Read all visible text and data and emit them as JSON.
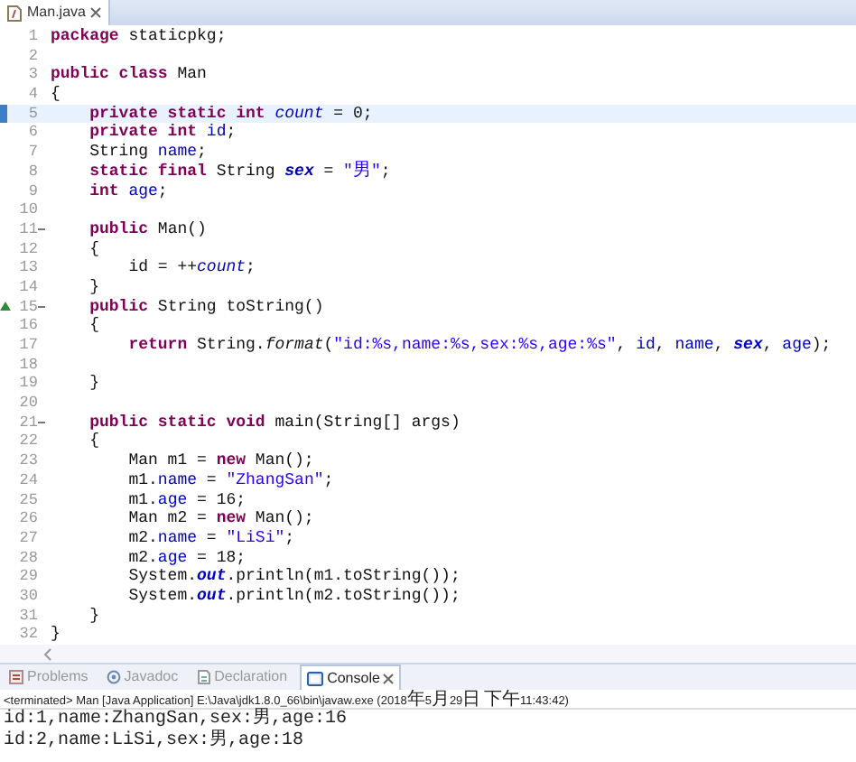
{
  "editor_tab": {
    "title": "Man.java",
    "selected": true
  },
  "lines": [
    {
      "number": "1",
      "current": false,
      "fold": false,
      "override": false,
      "tokens": [
        {
          "kind": "kw",
          "text": "package"
        },
        {
          "kind": "plain",
          "text": " staticpkg;"
        }
      ]
    },
    {
      "number": "2",
      "current": false,
      "fold": false,
      "override": false
    },
    {
      "number": "3",
      "current": false,
      "fold": false,
      "override": false,
      "tokens": [
        {
          "kind": "kw",
          "text": "public class"
        },
        {
          "kind": "plain",
          "text": " Man"
        }
      ]
    },
    {
      "number": "4",
      "current": false,
      "fold": false,
      "override": false,
      "tokens": [
        {
          "kind": "plain",
          "text": "{"
        }
      ]
    },
    {
      "number": "5",
      "current": true,
      "fold": false,
      "override": false,
      "tokens": [
        {
          "kind": "kw",
          "text": "    private static int "
        },
        {
          "kind": "sfield",
          "text": "count"
        },
        {
          "kind": "plain",
          "text": " = 0;"
        }
      ]
    },
    {
      "number": "6",
      "current": false,
      "fold": false,
      "override": false,
      "tokens": [
        {
          "kind": "kw",
          "text": "    private int "
        },
        {
          "kind": "field",
          "text": "id"
        },
        {
          "kind": "plain",
          "text": ";"
        }
      ]
    },
    {
      "number": "7",
      "current": false,
      "fold": false,
      "override": false,
      "tokens": [
        {
          "kind": "plain",
          "text": "    String "
        },
        {
          "kind": "field",
          "text": "name"
        },
        {
          "kind": "plain",
          "text": ";"
        }
      ]
    },
    {
      "number": "8",
      "current": false,
      "fold": false,
      "override": false,
      "tokens": [
        {
          "kind": "kw",
          "text": "    static final"
        },
        {
          "kind": "plain",
          "text": " String "
        },
        {
          "kind": "sfinal",
          "text": "sex"
        },
        {
          "kind": "plain",
          "text": " = "
        },
        {
          "kind": "str",
          "text": "\"男\""
        },
        {
          "kind": "plain",
          "text": ";"
        }
      ]
    },
    {
      "number": "9",
      "current": false,
      "fold": false,
      "override": false,
      "tokens": [
        {
          "kind": "kw",
          "text": "    int "
        },
        {
          "kind": "field",
          "text": "age"
        },
        {
          "kind": "plain",
          "text": ";"
        }
      ]
    },
    {
      "number": "10",
      "current": false,
      "fold": false,
      "override": false
    },
    {
      "number": "11",
      "current": false,
      "fold": true,
      "override": false,
      "tokens": [
        {
          "kind": "kw",
          "text": "    public"
        },
        {
          "kind": "plain",
          "text": " Man()"
        }
      ]
    },
    {
      "number": "12",
      "current": false,
      "fold": false,
      "override": false,
      "tokens": [
        {
          "kind": "plain",
          "text": "    {"
        }
      ]
    },
    {
      "number": "13",
      "current": false,
      "fold": false,
      "override": false,
      "tokens": [
        {
          "kind": "plain",
          "text": "        id = ++"
        },
        {
          "kind": "sfield",
          "text": "count"
        },
        {
          "kind": "plain",
          "text": ";"
        }
      ]
    },
    {
      "number": "14",
      "current": false,
      "fold": false,
      "override": false,
      "tokens": [
        {
          "kind": "plain",
          "text": "    }"
        }
      ]
    },
    {
      "number": "15",
      "current": false,
      "fold": true,
      "override": true,
      "tokens": [
        {
          "kind": "kw",
          "text": "    public"
        },
        {
          "kind": "plain",
          "text": " String toString()"
        }
      ]
    },
    {
      "number": "16",
      "current": false,
      "fold": false,
      "override": false,
      "tokens": [
        {
          "kind": "plain",
          "text": "    {"
        }
      ]
    },
    {
      "number": "17",
      "current": false,
      "fold": false,
      "override": false,
      "tokens": [
        {
          "kind": "kw",
          "text": "        return"
        },
        {
          "kind": "plain",
          "text": " String."
        },
        {
          "kind": "smethod",
          "text": "format"
        },
        {
          "kind": "plain",
          "text": "("
        },
        {
          "kind": "str",
          "text": "\"id:%s,name:%s,sex:%s,age:%s\""
        },
        {
          "kind": "plain",
          "text": ", "
        },
        {
          "kind": "field",
          "text": "id"
        },
        {
          "kind": "plain",
          "text": ", "
        },
        {
          "kind": "field",
          "text": "name"
        },
        {
          "kind": "plain",
          "text": ", "
        },
        {
          "kind": "sfinal",
          "text": "sex"
        },
        {
          "kind": "plain",
          "text": ", "
        },
        {
          "kind": "field",
          "text": "age"
        },
        {
          "kind": "plain",
          "text": ");"
        }
      ]
    },
    {
      "number": "18",
      "current": false,
      "fold": false,
      "override": false
    },
    {
      "number": "19",
      "current": false,
      "fold": false,
      "override": false,
      "tokens": [
        {
          "kind": "plain",
          "text": "    }"
        }
      ]
    },
    {
      "number": "20",
      "current": false,
      "fold": false,
      "override": false
    },
    {
      "number": "21",
      "current": false,
      "fold": true,
      "override": false,
      "tokens": [
        {
          "kind": "kw",
          "text": "    public static void"
        },
        {
          "kind": "plain",
          "text": " main(String[] args)"
        }
      ]
    },
    {
      "number": "22",
      "current": false,
      "fold": false,
      "override": false,
      "tokens": [
        {
          "kind": "plain",
          "text": "    {"
        }
      ]
    },
    {
      "number": "23",
      "current": false,
      "fold": false,
      "override": false,
      "tokens": [
        {
          "kind": "plain",
          "text": "        Man m1 = "
        },
        {
          "kind": "kw",
          "text": "new"
        },
        {
          "kind": "plain",
          "text": " Man();"
        }
      ]
    },
    {
      "number": "24",
      "current": false,
      "fold": false,
      "override": false,
      "tokens": [
        {
          "kind": "plain",
          "text": "        m1."
        },
        {
          "kind": "field",
          "text": "name"
        },
        {
          "kind": "plain",
          "text": " = "
        },
        {
          "kind": "str",
          "text": "\"ZhangSan\""
        },
        {
          "kind": "plain",
          "text": ";"
        }
      ]
    },
    {
      "number": "25",
      "current": false,
      "fold": false,
      "override": false,
      "tokens": [
        {
          "kind": "plain",
          "text": "        m1."
        },
        {
          "kind": "field",
          "text": "age"
        },
        {
          "kind": "plain",
          "text": " = 16;"
        }
      ]
    },
    {
      "number": "26",
      "current": false,
      "fold": false,
      "override": false,
      "tokens": [
        {
          "kind": "plain",
          "text": "        Man m2 = "
        },
        {
          "kind": "kw",
          "text": "new"
        },
        {
          "kind": "plain",
          "text": " Man();"
        }
      ]
    },
    {
      "number": "27",
      "current": false,
      "fold": false,
      "override": false,
      "tokens": [
        {
          "kind": "plain",
          "text": "        m2."
        },
        {
          "kind": "field",
          "text": "name"
        },
        {
          "kind": "plain",
          "text": " = "
        },
        {
          "kind": "str",
          "text": "\"LiSi\""
        },
        {
          "kind": "plain",
          "text": ";"
        }
      ]
    },
    {
      "number": "28",
      "current": false,
      "fold": false,
      "override": false,
      "tokens": [
        {
          "kind": "plain",
          "text": "        m2."
        },
        {
          "kind": "field",
          "text": "age"
        },
        {
          "kind": "plain",
          "text": " = 18;"
        }
      ]
    },
    {
      "number": "29",
      "current": false,
      "fold": false,
      "override": false,
      "tokens": [
        {
          "kind": "plain",
          "text": "        System."
        },
        {
          "kind": "sfinal",
          "text": "out"
        },
        {
          "kind": "plain",
          "text": ".println(m1.toString());"
        }
      ]
    },
    {
      "number": "30",
      "current": false,
      "fold": false,
      "override": false,
      "tokens": [
        {
          "kind": "plain",
          "text": "        System."
        },
        {
          "kind": "sfinal",
          "text": "out"
        },
        {
          "kind": "plain",
          "text": ".println(m2.toString());"
        }
      ]
    },
    {
      "number": "31",
      "current": false,
      "fold": false,
      "override": false,
      "tokens": [
        {
          "kind": "plain",
          "text": "    }"
        }
      ]
    },
    {
      "number": "32",
      "current": false,
      "fold": false,
      "override": false,
      "tokens": [
        {
          "kind": "plain",
          "text": "}"
        }
      ]
    }
  ],
  "view_tabs": [
    {
      "kind": "problems",
      "label": "Problems",
      "selected": false
    },
    {
      "kind": "javadoc",
      "label": "Javadoc",
      "selected": false
    },
    {
      "kind": "declaration",
      "label": "Declaration",
      "selected": false
    },
    {
      "kind": "console",
      "label": "Console",
      "selected": true
    }
  ],
  "console": {
    "status": "<terminated> Man [Java Application] E:\\Java\\jdk1.8.0_66\\bin\\javaw.exe (2018年5月29日 下午11:43:42)",
    "output": [
      "id:1,name:ZhangSan,sex:男,age:16",
      "id:2,name:LiSi,sex:男,age:18"
    ]
  }
}
